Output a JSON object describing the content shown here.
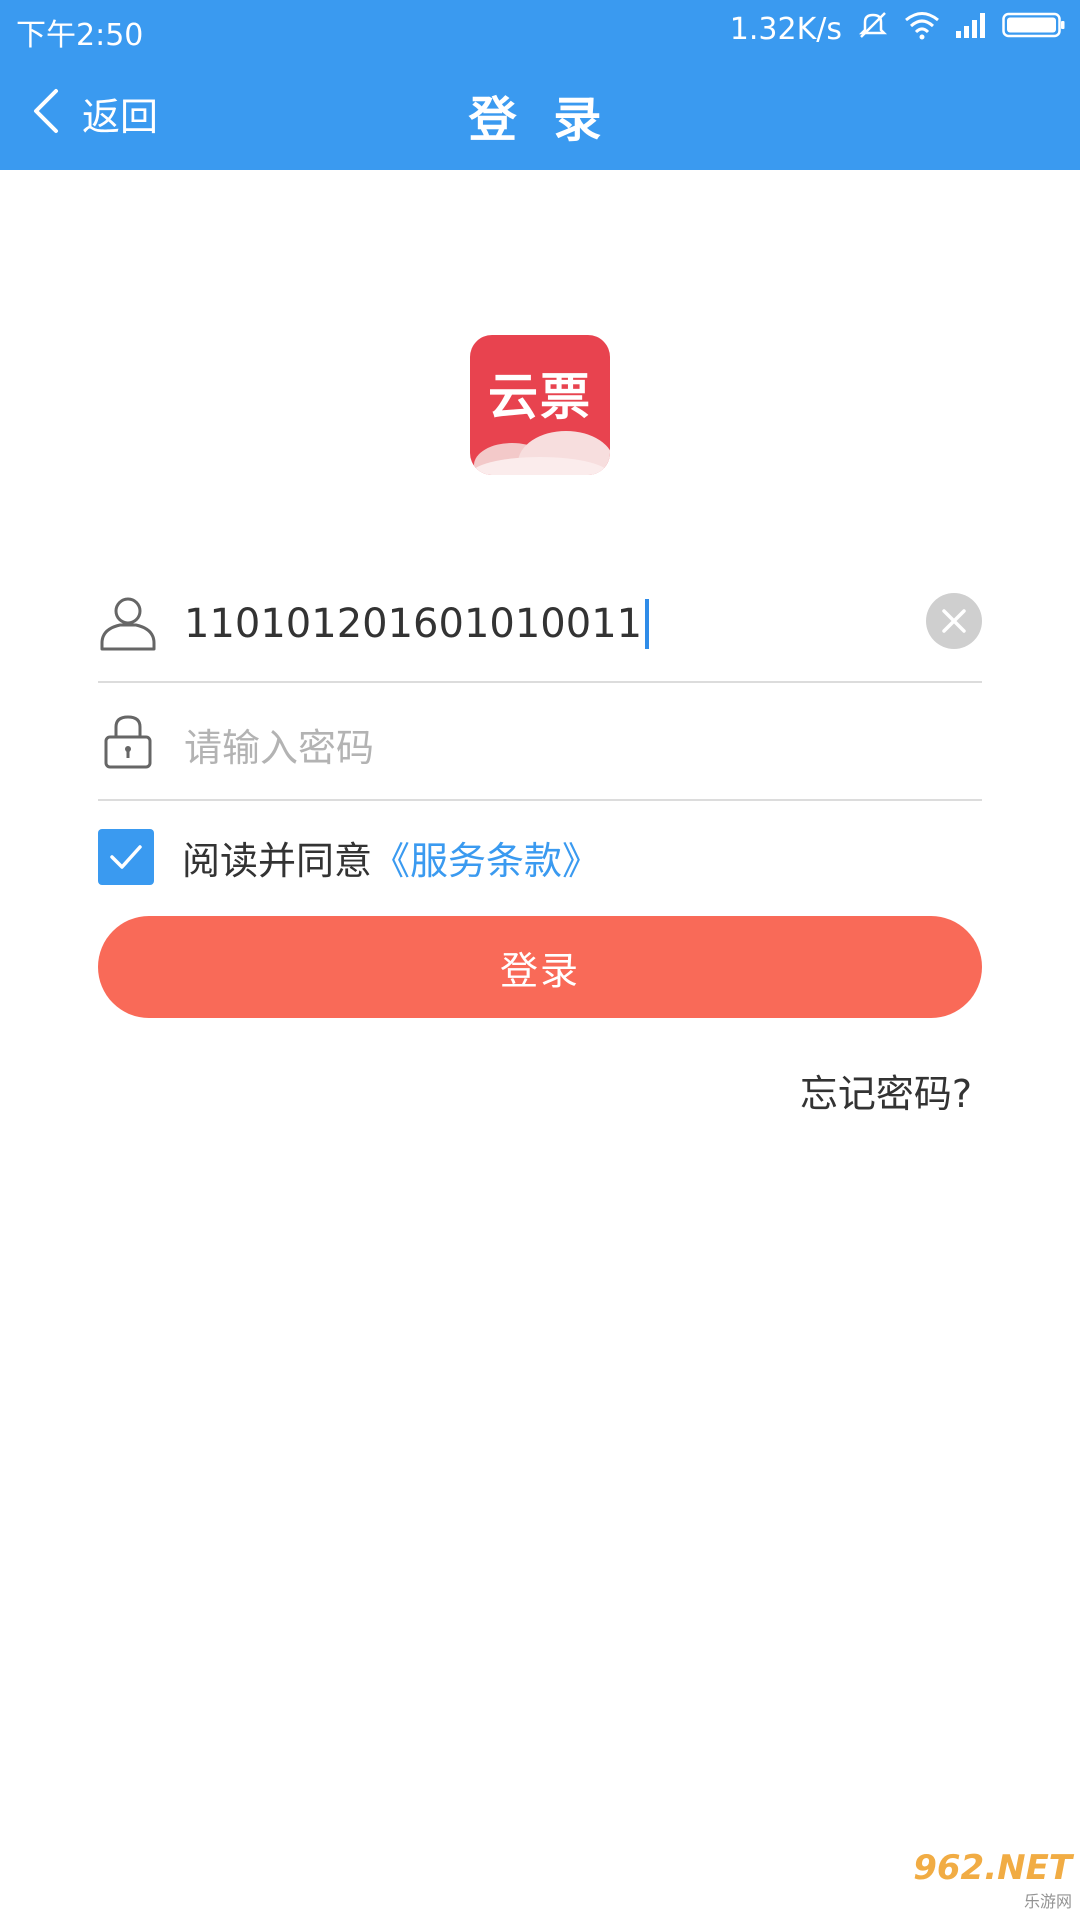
{
  "status_bar": {
    "time": "下午2:50",
    "network_speed": "1.32K/s"
  },
  "nav": {
    "back_label": "返回",
    "title": "登 录"
  },
  "logo": {
    "text": "云票"
  },
  "form": {
    "username_value": "110101201601010011",
    "password_placeholder": "请输入密码",
    "agree_checked": true,
    "agree_text": "阅读并同意",
    "terms_link": "《服务条款》",
    "login_button": "登录",
    "forgot_password": "忘记密码?"
  },
  "watermark": {
    "main": "962.NET",
    "sub": "乐游网"
  },
  "colors": {
    "header": "#3a9af0",
    "login_button": "#f96a58",
    "logo_bg": "#e8434f",
    "link": "#3a9af0"
  }
}
